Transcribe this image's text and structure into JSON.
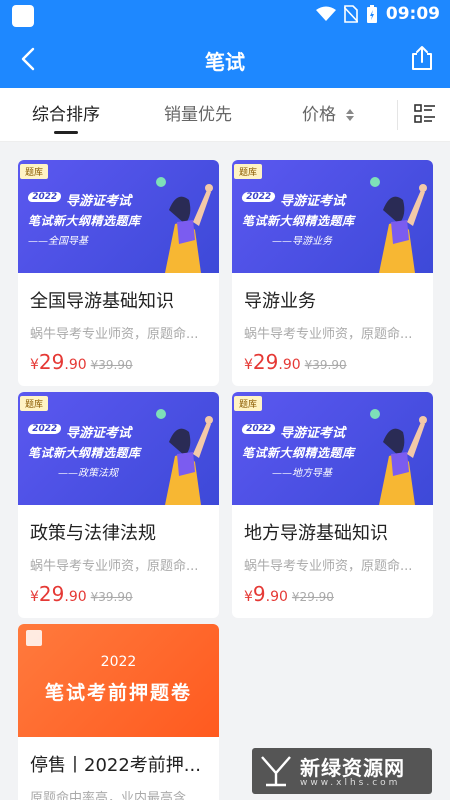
{
  "status_bar": {
    "time": "09:09"
  },
  "header": {
    "title": "笔试"
  },
  "tabs": [
    {
      "label": "综合排序"
    },
    {
      "label": "销量优先"
    },
    {
      "label": "价格"
    }
  ],
  "products": [
    {
      "tag": "题库",
      "banner_year": "2022",
      "banner_line1": "导游证考试",
      "banner_line2": "笔试新大纲精选题库",
      "banner_line3": "——全国导基",
      "title": "全国导游基础知识",
      "subtitle": "蜗牛导考专业师资，原题命...",
      "currency": "¥",
      "price_int": "29",
      "price_dec": ".90",
      "old_price": "¥39.90"
    },
    {
      "tag": "题库",
      "banner_year": "2022",
      "banner_line1": "导游证考试",
      "banner_line2": "笔试新大纲精选题库",
      "banner_line3": "——导游业务",
      "title": "导游业务",
      "subtitle": "蜗牛导考专业师资，原题命...",
      "currency": "¥",
      "price_int": "29",
      "price_dec": ".90",
      "old_price": "¥39.90"
    },
    {
      "tag": "题库",
      "banner_year": "2022",
      "banner_line1": "导游证考试",
      "banner_line2": "笔试新大纲精选题库",
      "banner_line3": "——政策法规",
      "title": "政策与法律法规",
      "subtitle": "蜗牛导考专业师资，原题命...",
      "currency": "¥",
      "price_int": "29",
      "price_dec": ".90",
      "old_price": "¥39.90"
    },
    {
      "tag": "题库",
      "banner_year": "2022",
      "banner_line1": "导游证考试",
      "banner_line2": "笔试新大纲精选题库",
      "banner_line3": "——地方导基",
      "title": "地方导游基础知识",
      "subtitle": "蜗牛导考专业师资，原题命...",
      "currency": "¥",
      "price_int": "9",
      "price_dec": ".90",
      "old_price": "¥29.90"
    },
    {
      "banner_year": "2022",
      "banner_title": "笔试考前押题卷",
      "title": "停售丨2022考前押...",
      "subtitle": "原题命中率高，业内最高含"
    }
  ],
  "watermark": {
    "text": "新绿资源网",
    "sub": "www.xlhs.com"
  },
  "colors": {
    "primary": "#1e88ff",
    "price": "#e53935",
    "banner_blue": "#4a4fe6",
    "banner_orange": "#ff6a2b"
  }
}
